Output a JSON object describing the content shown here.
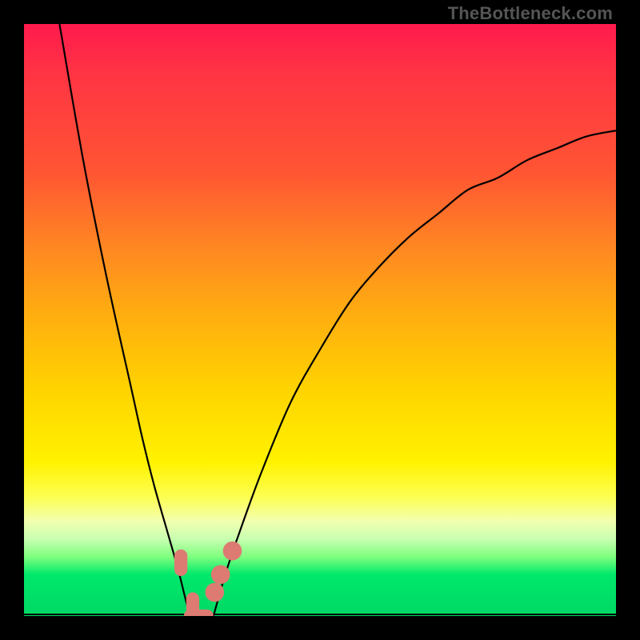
{
  "watermark": "TheBottleneck.com",
  "colors": {
    "frame": "#000000",
    "marker": "#dd7b72",
    "curve": "#000000"
  },
  "chart_data": {
    "type": "line",
    "title": "",
    "xlabel": "",
    "ylabel": "",
    "xlim": [
      0,
      100
    ],
    "ylim": [
      0,
      100
    ],
    "grid": false,
    "series": [
      {
        "name": "left-curve",
        "x": [
          6,
          10,
          14,
          18,
          20,
          22,
          24,
          26,
          27,
          28
        ],
        "y": [
          100,
          77,
          57,
          39,
          30,
          22,
          15,
          8,
          4,
          0
        ]
      },
      {
        "name": "right-curve",
        "x": [
          32,
          34,
          36,
          40,
          45,
          50,
          55,
          60,
          65,
          70,
          75,
          80,
          85,
          90,
          95,
          100
        ],
        "y": [
          0,
          7,
          13,
          24,
          36,
          45,
          53,
          59,
          64,
          68,
          72,
          74,
          77,
          79,
          81,
          82
        ]
      },
      {
        "name": "baseline",
        "x": [
          0,
          100
        ],
        "y": [
          0,
          0
        ]
      }
    ],
    "markers": [
      {
        "shape": "pill",
        "x": 26.5,
        "y": 9,
        "w": 2.2,
        "h": 4.5
      },
      {
        "shape": "pill",
        "x": 28.5,
        "y": 2,
        "w": 2.2,
        "h": 4
      },
      {
        "shape": "pill",
        "x": 29.5,
        "y": 0,
        "w": 5,
        "h": 2.2
      },
      {
        "shape": "dot",
        "x": 32.2,
        "y": 4,
        "r": 1.6
      },
      {
        "shape": "dot",
        "x": 33.2,
        "y": 7,
        "r": 1.6
      },
      {
        "shape": "dot",
        "x": 35.2,
        "y": 11,
        "r": 1.6
      }
    ]
  }
}
